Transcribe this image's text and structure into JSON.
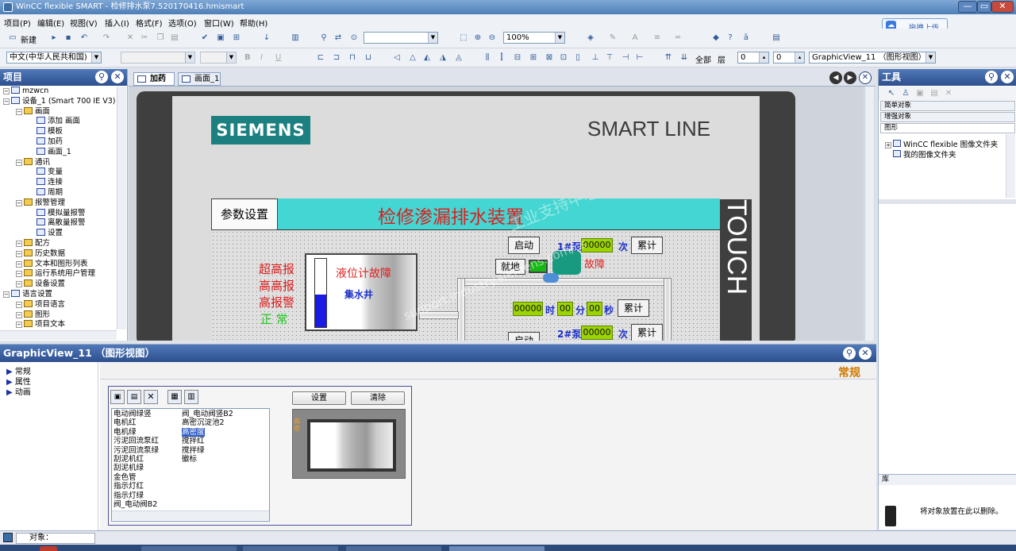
{
  "window": {
    "title": "WinCC flexible SMART - 检修排水泵7.520170416.hmismart",
    "min_label": "—",
    "max_label": "▭",
    "close_label": "✕"
  },
  "menu": [
    "项目(P)",
    "编辑(E)",
    "视图(V)",
    "插入(I)",
    "格式(F)",
    "选项(O)",
    "窗口(W)",
    "帮助(H)"
  ],
  "upload_button": "拖拽上传",
  "toolbar": {
    "new_label": "新建",
    "zoom_value": "100%",
    "language_value": "中文(中华人民共和国)",
    "all_label": "全部",
    "layer_label": "层",
    "layer_from": "0",
    "layer_to": "0",
    "object_select": "GraphicView_11 （图形视图）",
    "bold": "B",
    "italic": "I",
    "underline": "U"
  },
  "project_panel": {
    "title": "项目",
    "tree": [
      {
        "label": "mzwcn",
        "level": 0
      },
      {
        "label": "设备_1 (Smart 700 IE V3)",
        "level": 0
      },
      {
        "label": "画面",
        "level": 1
      },
      {
        "label": "添加 画面",
        "level": 2
      },
      {
        "label": "模板",
        "level": 2
      },
      {
        "label": "加药",
        "level": 2
      },
      {
        "label": "画面_1",
        "level": 2
      },
      {
        "label": "通讯",
        "level": 1
      },
      {
        "label": "变量",
        "level": 2
      },
      {
        "label": "连接",
        "level": 2
      },
      {
        "label": "周期",
        "level": 2
      },
      {
        "label": "报警管理",
        "level": 1
      },
      {
        "label": "模拟量报警",
        "level": 2
      },
      {
        "label": "离散量报警",
        "level": 2
      },
      {
        "label": "设置",
        "level": 2
      },
      {
        "label": "配方",
        "level": 1
      },
      {
        "label": "历史数据",
        "level": 1
      },
      {
        "label": "文本和图形列表",
        "level": 1
      },
      {
        "label": "运行系统用户管理",
        "level": 1
      },
      {
        "label": "设备设置",
        "level": 1
      },
      {
        "label": "语言设置",
        "level": 0
      },
      {
        "label": "项目语言",
        "level": 1
      },
      {
        "label": "图形",
        "level": 1
      },
      {
        "label": "项目文本",
        "level": 1
      }
    ]
  },
  "editor_tabs": [
    "加药",
    "画面_1"
  ],
  "hmi": {
    "brand": "SIEMENS",
    "product_line": "SMART LINE",
    "side_text": "TOUCH",
    "param_button": "参数设置",
    "screen_title": "检修渗漏排水装置",
    "alarm_ultra_high": "超高报",
    "alarm_high_high": "高高报",
    "alarm_high": "高报警",
    "status_normal": "正 常",
    "level_fault": "液位计故障",
    "sump_label": "集水井",
    "level_fill_pct": 48,
    "start_label": "启动",
    "local_label": "就地",
    "pump1_label": "1#泵",
    "pump1_count": "00000",
    "times_label": "次",
    "accumulate_label": "累计",
    "fault_label": "故障",
    "runtime_value": "00000",
    "hour_label": "时",
    "hour_value": "00",
    "minute_label": "分",
    "minute_value": "00",
    "second_label": "秒",
    "pump2_label": "2#泵",
    "pump2_count": "00000",
    "watermark": "support.industry.siemens.com/cs",
    "watermark2": "工业支持中心 答案"
  },
  "tools_panel": {
    "title": "工具",
    "sections": [
      "简单对象",
      "增强对象",
      "图形"
    ],
    "tree": [
      "WinCC flexible 图像文件夹",
      "我的图像文件夹"
    ],
    "library_title": "库",
    "library_hint": "将对象放置在此以删除。"
  },
  "properties_panel": {
    "title": "GraphicView_11 （图形视图）",
    "nav": [
      "常规",
      "属性",
      "动画"
    ],
    "section_title": "常规",
    "set_button": "设置",
    "clear_button": "清除",
    "list_col1": [
      "电动阀绿竖",
      "电机红",
      "电机绿",
      "污泥回流泵红",
      "污泥回流泵绿",
      "刮泥机红",
      "刮泥机绿",
      "金色管",
      "指示灯红",
      "指示灯绿",
      "阀_电动阀B2"
    ],
    "list_col2": [
      "阀_电动阀竖B2",
      "高密沉淀池2",
      "高密度",
      "搅拌红",
      "搅拌绿",
      "徽标"
    ],
    "selected_item": "高密度",
    "preview_label": "高密"
  },
  "statusbar": {
    "object_label": "对象："
  }
}
